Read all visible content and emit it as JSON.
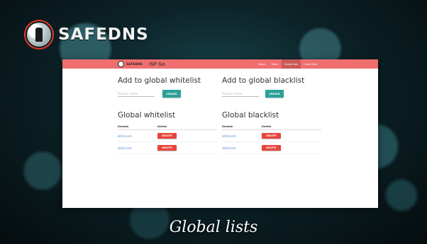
{
  "brand": {
    "name": "SAFEDNS"
  },
  "navbar": {
    "brand": "SAFEDNS",
    "title": "ISP Go",
    "links": [
      "Home",
      "Users",
      "Global lists",
      "Check site"
    ],
    "active_index": 2
  },
  "whitelist_form": {
    "title": "Add to global whitelist",
    "placeholder": "Domain name",
    "button": "CREATE"
  },
  "blacklist_form": {
    "title": "Add to global blacklist",
    "placeholder": "Domain name",
    "button": "CREATE"
  },
  "whitelist": {
    "title": "Global whitelist",
    "columns": [
      "Domain",
      "Delete"
    ],
    "rows": [
      {
        "domain": "site1.com",
        "action": "DELETE"
      },
      {
        "domain": "site2.com",
        "action": "DELETE"
      }
    ]
  },
  "blacklist": {
    "title": "Global blacklist",
    "columns": [
      "Domain",
      "Delete"
    ],
    "rows": [
      {
        "domain": "site3.com",
        "action": "DELETE"
      },
      {
        "domain": "site4.com",
        "action": "DELETE"
      }
    ]
  },
  "caption": "Global lists",
  "colors": {
    "navbar": "#ef6f6f",
    "create_button": "#2aa198",
    "delete_button": "#e8443a",
    "link": "#3f7fcf"
  }
}
